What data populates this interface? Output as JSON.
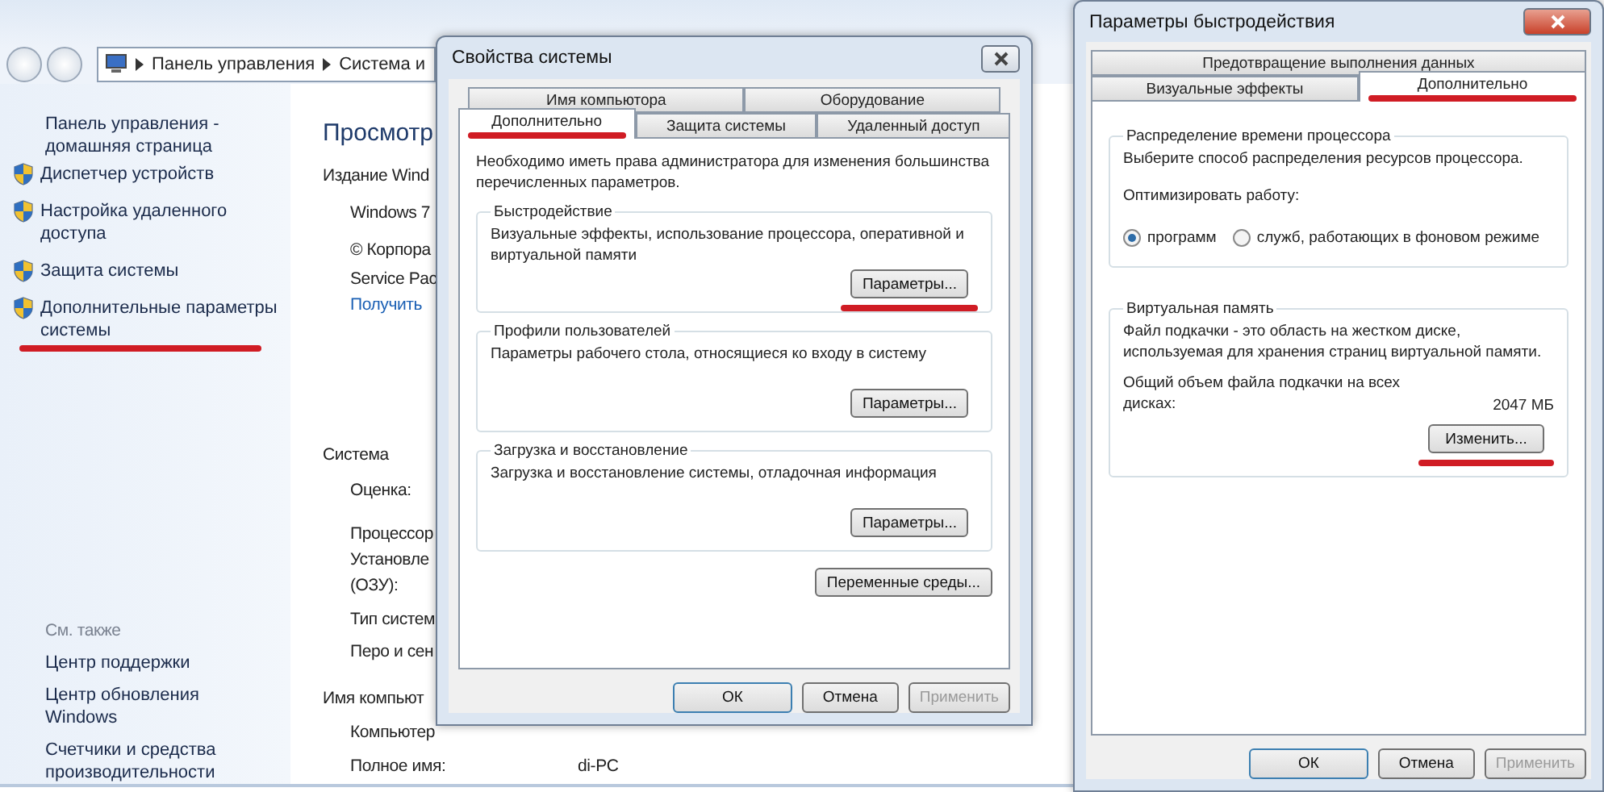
{
  "control_panel": {
    "address": [
      "Панель управления",
      "Система и"
    ],
    "sidebar": {
      "home_link": "Панель управления - домашняя страница",
      "links": [
        {
          "label": "Диспетчер устройств",
          "underlined": false
        },
        {
          "label": "Настройка удаленного доступа",
          "underlined": false
        },
        {
          "label": "Защита системы",
          "underlined": false
        },
        {
          "label": "Дополнительные параметры системы",
          "underlined": true
        }
      ],
      "see_also_title": "См. также",
      "see_also": [
        "Центр поддержки",
        "Центр обновления Windows",
        "Счетчики и средства производительности"
      ]
    },
    "main": {
      "heading": "Просмотр",
      "edition_title": "Издание Wind",
      "edition_lines": [
        {
          "text": "Windows 7",
          "kind": "text"
        },
        {
          "text": "© Корпора",
          "kind": "text"
        },
        {
          "text": "Service Pac",
          "kind": "text"
        },
        {
          "text": "Получить",
          "kind": "link"
        }
      ],
      "system_title": "Система",
      "system_rows": [
        "Оценка:",
        "Процессор",
        "Установле",
        "(ОЗУ):",
        "Тип систем",
        "Перо и сен"
      ],
      "name_title": "Имя компьют",
      "name_rows": [
        {
          "label": "Компьютер"
        },
        {
          "label": "Полное имя:",
          "value": "di-PC"
        }
      ]
    }
  },
  "system_properties": {
    "title": "Свойства системы",
    "tab_rows": [
      [
        {
          "label": "Имя компьютора",
          "selected": false,
          "underlined": false
        },
        {
          "label": "Оборудование",
          "selected": false,
          "underlined": false
        }
      ],
      [
        {
          "label": "Дополнительно",
          "selected": true,
          "underlined": true
        },
        {
          "label": "Защита системы",
          "selected": false,
          "underlined": false
        },
        {
          "label": "Удаленный доступ",
          "selected": false,
          "underlined": false
        }
      ]
    ],
    "notice": "Необходимо иметь права администратора для изменения большинства перечисленных параметров.",
    "groups": [
      {
        "title": "Быстродействие",
        "text": "Визуальные эффекты, использование процессора, оперативной и виртуальной памяти",
        "button": "Параметры...",
        "underlined": true
      },
      {
        "title": "Профили пользователей",
        "text": "Параметры рабочего стола, относящиеся ко входу в систему",
        "button": "Параметры...",
        "underlined": false
      },
      {
        "title": "Загрузка и восстановление",
        "text": "Загрузка и восстановление системы, отладочная информация",
        "button": "Параметры...",
        "underlined": false
      }
    ],
    "env_button": "Переменные среды...",
    "buttons": [
      {
        "label": "ОК",
        "disabled": false
      },
      {
        "label": "Отмена",
        "disabled": false
      },
      {
        "label": "Применить",
        "disabled": true
      }
    ]
  },
  "performance_options": {
    "title": "Параметры быстродействия",
    "tab_rows": [
      [
        {
          "label": "Предотвращение выполнения данных",
          "selected": false,
          "underlined": false
        }
      ],
      [
        {
          "label": "Визуальные эффекты",
          "selected": false,
          "underlined": false
        },
        {
          "label": "Дополнительно",
          "selected": true,
          "underlined": true
        }
      ]
    ],
    "cpu_group": {
      "title": "Распределение времени процессора",
      "text": "Выберите способ распределения ресурсов процессора.",
      "optimize_label": "Оптимизировать работу:",
      "options": [
        {
          "label": "программ",
          "selected": true
        },
        {
          "label": "служб, работающих в фоновом режиме",
          "selected": false
        }
      ]
    },
    "memory_group": {
      "title": "Виртуальная память",
      "text": "Файл подкачки - это область на жестком диске, используемая для хранения страниц виртуальной памяти.",
      "total_label": "Общий объем файла подкачки на всех дисках:",
      "total_value": "2047 МБ",
      "button": "Изменить...",
      "underlined": true
    },
    "buttons": [
      {
        "label": "ОК",
        "disabled": false
      },
      {
        "label": "Отмена",
        "disabled": false
      },
      {
        "label": "Применить",
        "disabled": true
      }
    ]
  }
}
